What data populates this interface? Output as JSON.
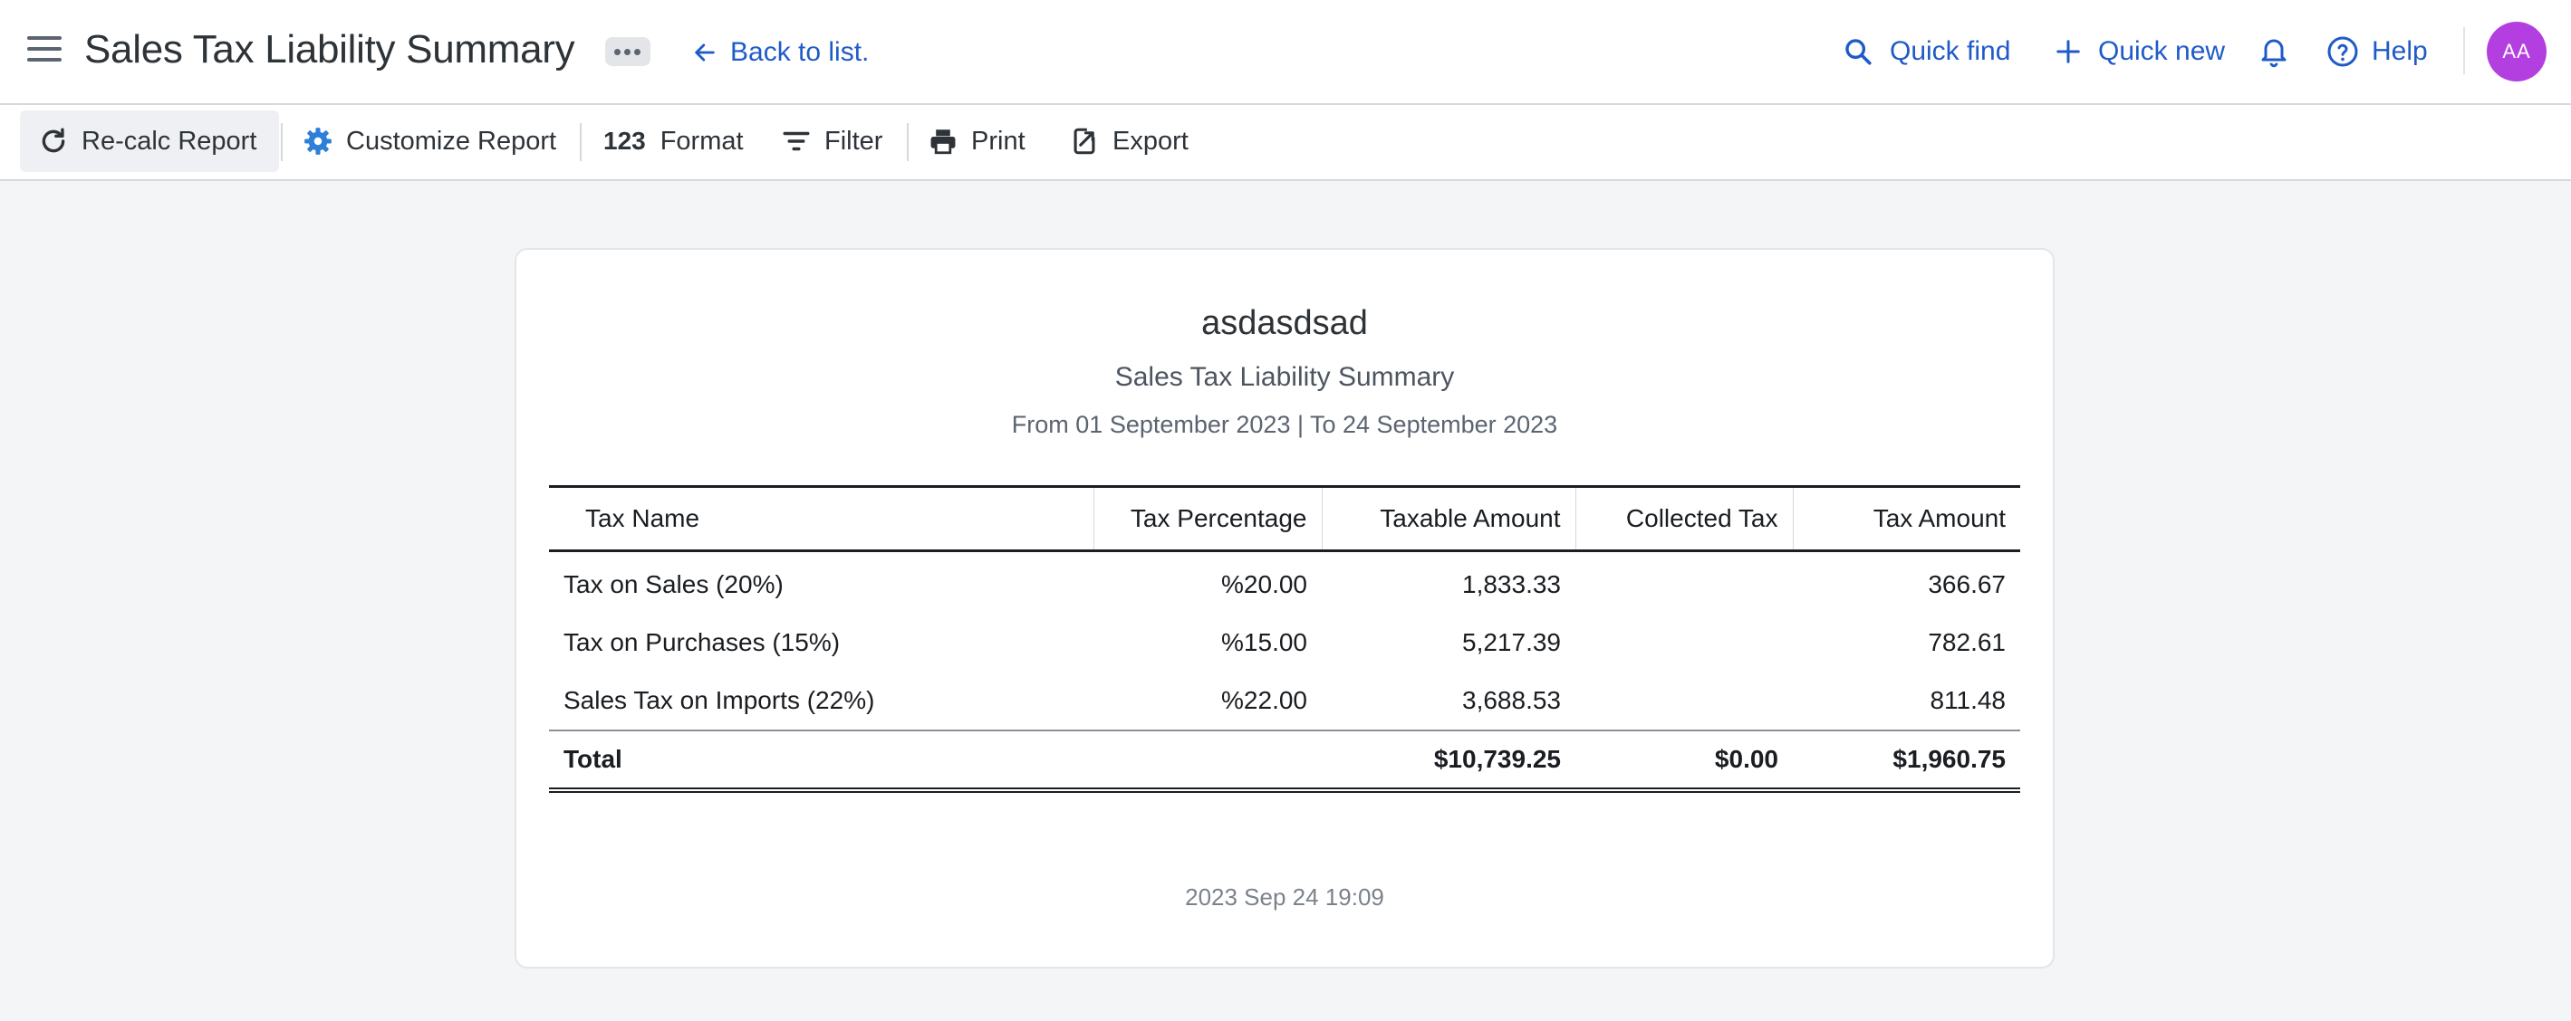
{
  "header": {
    "title": "Sales Tax Liability Summary",
    "back_label": "Back to list.",
    "quick_find_label": "Quick find",
    "quick_new_label": "Quick new",
    "help_label": "Help",
    "avatar_initials": "AA",
    "avatar_color": "#b43fe1",
    "accent_color": "#1f5bc8"
  },
  "toolbar": {
    "recalc_label": "Re-calc Report",
    "customize_label": "Customize Report",
    "format_number": "123",
    "format_label": "Format",
    "filter_label": "Filter",
    "print_label": "Print",
    "export_label": "Export"
  },
  "report": {
    "company": "asdasdsad",
    "title": "Sales Tax Liability Summary",
    "date_range": "From 01 September 2023 | To 24 September 2023",
    "columns": [
      "Tax Name",
      "Tax Percentage",
      "Taxable Amount",
      "Collected Tax",
      "Tax Amount"
    ],
    "rows": [
      {
        "name": "Tax on Sales (20%)",
        "percentage": "%20.00",
        "taxable": "1,833.33",
        "collected": "",
        "tax": "366.67"
      },
      {
        "name": "Tax on Purchases (15%)",
        "percentage": "%15.00",
        "taxable": "5,217.39",
        "collected": "",
        "tax": "782.61"
      },
      {
        "name": "Sales Tax on Imports (22%)",
        "percentage": "%22.00",
        "taxable": "3,688.53",
        "collected": "",
        "tax": "811.48"
      }
    ],
    "total": {
      "label": "Total",
      "percentage": "",
      "taxable": "$10,739.25",
      "collected": "$0.00",
      "tax": "$1,960.75"
    },
    "generated_at": "2023 Sep 24 19:09"
  }
}
